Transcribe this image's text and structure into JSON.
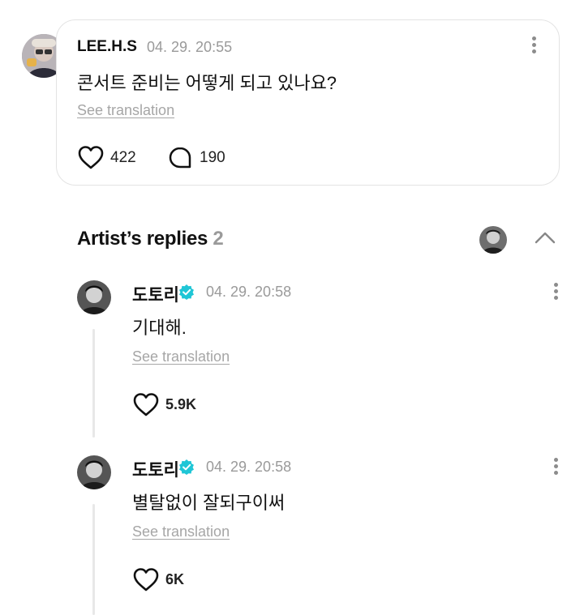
{
  "post": {
    "author": "LEE.H.S",
    "date": "04. 29. 20:55",
    "text": "콘서트 준비는 어떻게 되고 있나요?",
    "see_translation": "See translation",
    "likes": "422",
    "comments": "190",
    "avatar_icon": "user-avatar-photo"
  },
  "replies_section": {
    "title": "Artist’s replies",
    "count": "2"
  },
  "replies": [
    {
      "author": "도토리",
      "date": "04. 29. 20:58",
      "text": "기대해.",
      "see_translation": "See translation",
      "likes": "5.9K"
    },
    {
      "author": "도토리",
      "date": "04. 29. 20:58",
      "text": "별탈없이 잘되구이써",
      "see_translation": "See translation",
      "likes": "6K"
    }
  ],
  "colors": {
    "verified": "#1fc6d6",
    "muted": "#9a9a9a",
    "border": "#e3e3e3"
  }
}
